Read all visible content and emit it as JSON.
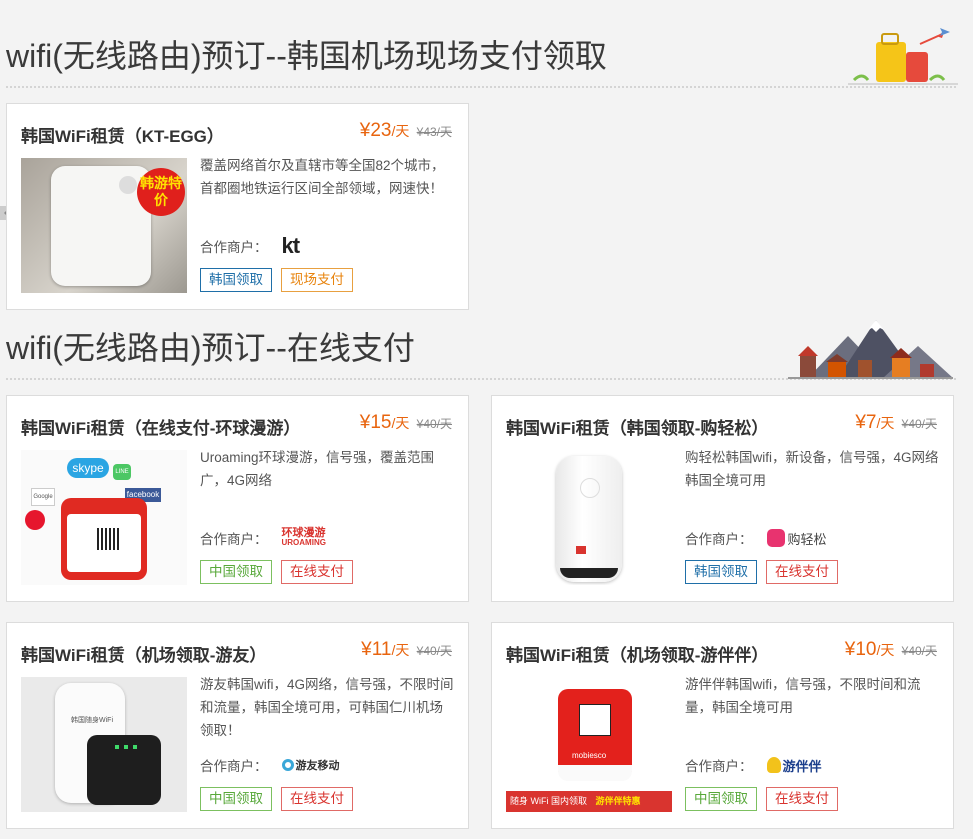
{
  "sections": [
    {
      "title": "wifi(无线路由)预订--韩国机场现场支付领取"
    },
    {
      "title": "wifi(无线路由)预订--在线支付"
    }
  ],
  "partner_label": "合作商户：",
  "cards": [
    {
      "name": "韩国WiFi租赁（KT-EGG）",
      "price": "¥23",
      "unit": "/天",
      "original": "¥43/天",
      "desc": "覆盖网络首尔及直辖市等全国82个城市，首都圈地铁运行区间全部领域，网速快！",
      "partner": "kt",
      "thumb_badge": "韩游特价",
      "tags": [
        "韩国领取",
        "现场支付"
      ]
    },
    {
      "name": "韩国WiFi租赁（在线支付-环球漫游）",
      "price": "¥15",
      "unit": "/天",
      "original": "¥40/天",
      "desc": "Uroaming环球漫游，信号强，覆盖范围广，4G网络",
      "partner": "环球漫游",
      "partner_sub": "UROAMING",
      "thumb_labels": [
        "skype",
        "LINE",
        "facebook",
        "Google"
      ],
      "tags": [
        "中国领取",
        "在线支付"
      ]
    },
    {
      "name": "韩国WiFi租赁（韩国领取-购轻松）",
      "price": "¥7",
      "unit": "/天",
      "original": "¥40/天",
      "desc": "购轻松韩国wifi，新设备，信号强，4G网络 韩国全境可用",
      "partner": "购轻松",
      "tags": [
        "韩国领取",
        "在线支付"
      ]
    },
    {
      "name": "韩国WiFi租赁（机场领取-游友）",
      "price": "¥11",
      "unit": "/天",
      "original": "¥40/天",
      "desc": "游友韩国wifi，4G网络，信号强，不限时间和流量，韩国全境可用，可韩国仁川机场领取！",
      "partner": "游友移动",
      "thumb_label": "韩国随身WiFi",
      "tags": [
        "中国领取",
        "在线支付"
      ]
    },
    {
      "name": "韩国WiFi租赁（机场领取-游伴伴）",
      "price": "¥10",
      "unit": "/天",
      "original": "¥40/天",
      "desc": "游伴伴韩国wifi，信号强，不限时间和流量，韩国全境可用",
      "partner": "游伴伴",
      "thumb_label": "mobiesco",
      "thumb_banner": [
        "随身 WiFi  国内领取",
        "游伴伴特惠"
      ],
      "tags": [
        "中国领取",
        "在线支付"
      ]
    }
  ],
  "colors": {
    "price": "#e8640e",
    "tag_blue": "#1f6fa8",
    "tag_orange": "#e8840e",
    "tag_green": "#58a83a",
    "tag_red": "#d9342f"
  }
}
